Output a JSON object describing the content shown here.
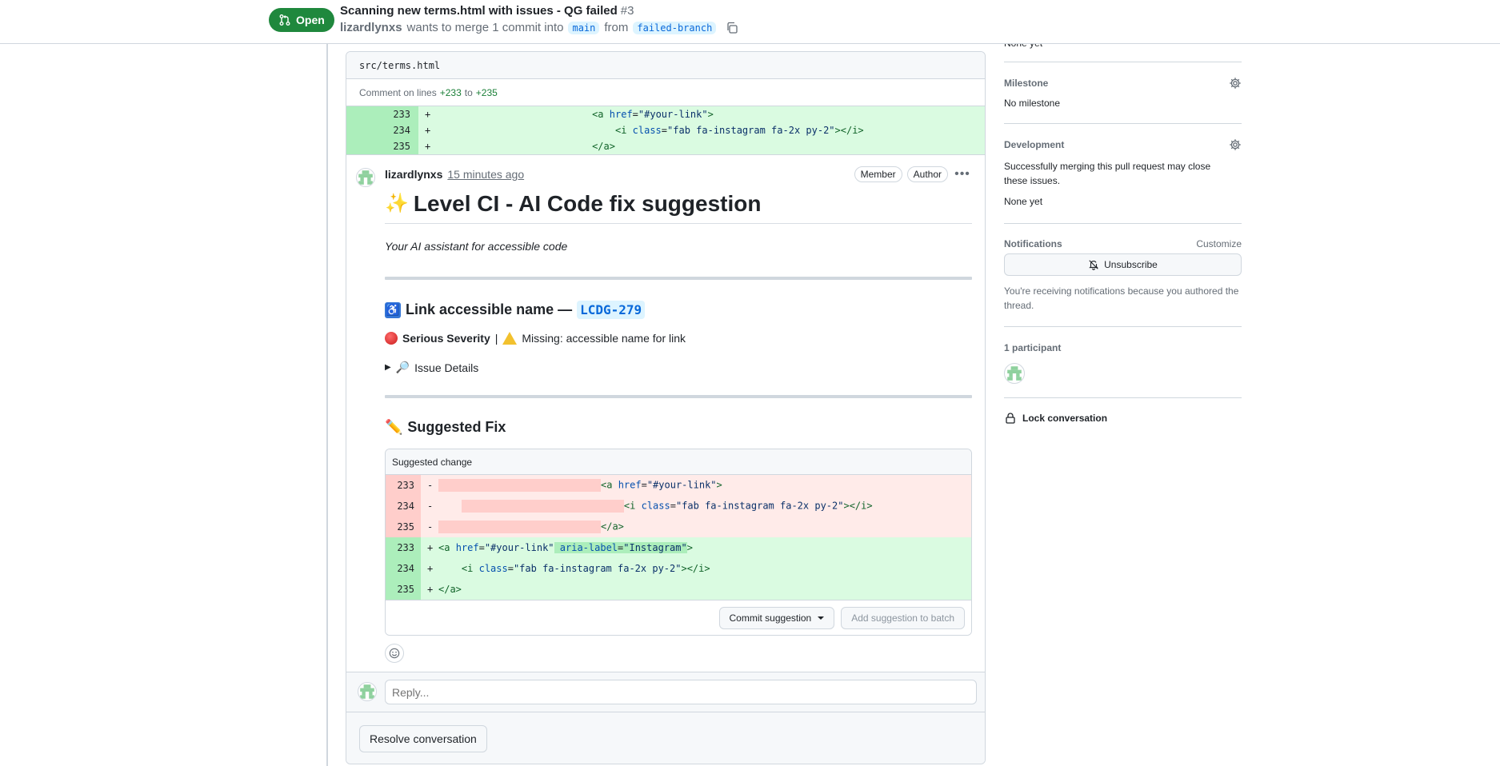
{
  "header": {
    "state": "Open",
    "title": "Scanning new terms.html with issues - QG failed",
    "number": "#3",
    "author": "lizardlynxs",
    "merge_text": "wants to merge 1 commit into",
    "base_branch": "main",
    "from_text": "from",
    "head_branch": "failed-branch",
    "state_color": "#1f883d"
  },
  "thread": {
    "file_path": "src/terms.html",
    "comment_on_prefix": "Comment on lines",
    "line_start": "+233",
    "to_text": "to",
    "line_end": "+235",
    "context_lines": [
      {
        "ln": "233",
        "sign": "+"
      },
      {
        "ln": "234",
        "sign": "+"
      },
      {
        "ln": "235",
        "sign": "+"
      }
    ]
  },
  "comment": {
    "author": "lizardlynxs",
    "time": "15 minutes ago",
    "badges": [
      "Member",
      "Author"
    ],
    "heading": "Level CI - AI Code fix suggestion",
    "tagline": "Your AI assistant for accessible code",
    "issue_title": "Link accessible name —",
    "issue_code": "LCDG-279",
    "severity_label": "Serious Severity",
    "severity_sep": "|",
    "missing_text": "Missing: accessible name for link",
    "details_label": "Issue Details",
    "fix_heading": "Suggested Fix",
    "suggested_change_label": "Suggested change",
    "diff_lines": [
      {
        "ln": "233",
        "sign": "-"
      },
      {
        "ln": "234",
        "sign": "-"
      },
      {
        "ln": "235",
        "sign": "-"
      },
      {
        "ln": "233",
        "sign": "+"
      },
      {
        "ln": "234",
        "sign": "+"
      },
      {
        "ln": "235",
        "sign": "+"
      }
    ],
    "commit_button": "Commit suggestion",
    "batch_button": "Add suggestion to batch"
  },
  "reply": {
    "placeholder": "Reply...",
    "resolve_button": "Resolve conversation"
  },
  "sidebar": {
    "top_text": "None yet",
    "milestone_title": "Milestone",
    "milestone_value": "No milestone",
    "development_title": "Development",
    "development_text": "Successfully merging this pull request may close these issues.",
    "development_value": "None yet",
    "notifications_title": "Notifications",
    "customize_link": "Customize",
    "unsubscribe_button": "Unsubscribe",
    "notifications_reason": "You're receiving notifications because you authored the thread.",
    "participants_title": "1 participant",
    "lock_label": "Lock conversation"
  },
  "icons": {
    "state": "git-pull-request-icon",
    "copy": "copy-icon",
    "gear": "gear-icon",
    "bell": "bell-slash-icon",
    "lock": "lock-icon",
    "kebab": "kebab-horizontal-icon",
    "smiley": "smiley-icon"
  }
}
